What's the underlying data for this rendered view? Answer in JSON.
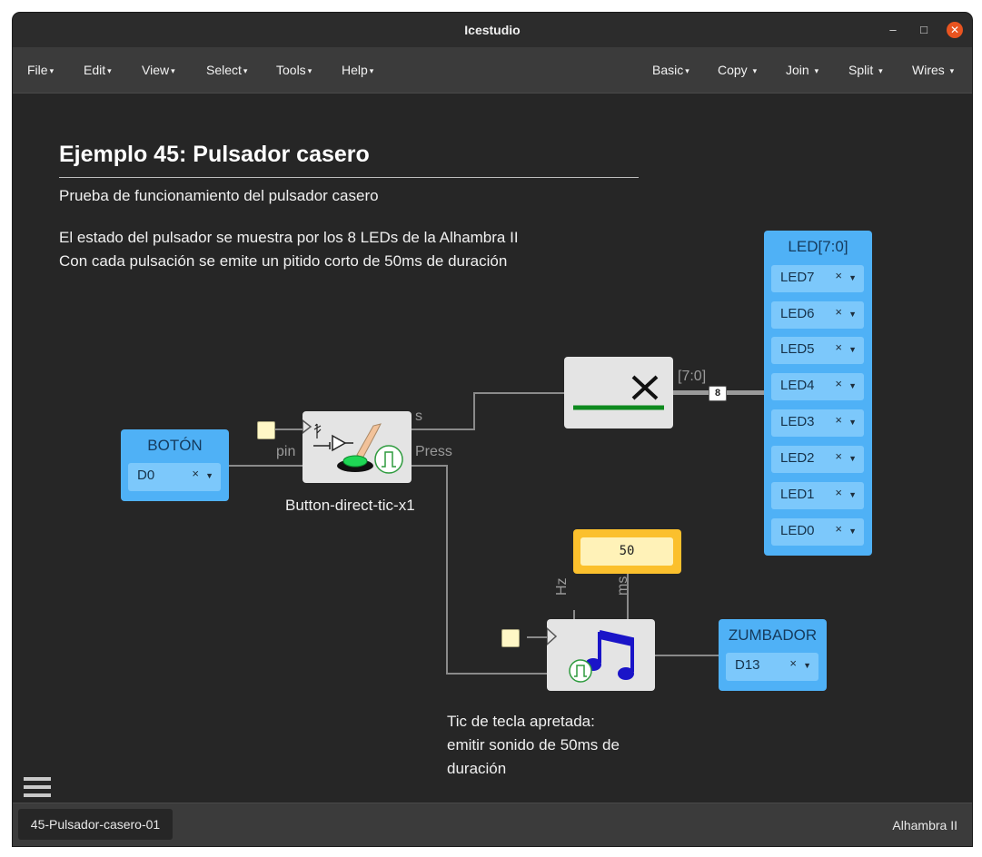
{
  "window": {
    "title": "Icestudio",
    "minimize": "–",
    "maximize": "□",
    "close": "✕"
  },
  "menu": {
    "left": [
      {
        "label": "File",
        "caret": "▾"
      },
      {
        "label": "Edit",
        "caret": "▾"
      },
      {
        "label": "View",
        "caret": "▾"
      },
      {
        "label": "Select",
        "caret": "▾"
      },
      {
        "label": "Tools",
        "caret": "▾"
      },
      {
        "label": "Help",
        "caret": "▾"
      }
    ],
    "right": [
      {
        "label": "Basic",
        "caret": "▾"
      },
      {
        "label": "Copy",
        "caret": "▾"
      },
      {
        "label": "Join",
        "caret": "▾"
      },
      {
        "label": "Split",
        "caret": "▾"
      },
      {
        "label": "Wires",
        "caret": "▾"
      }
    ]
  },
  "canvas": {
    "heading": "Ejemplo 45: Pulsador casero",
    "desc1": "Prueba de funcionamiento del pulsador casero",
    "desc2": "El estado del pulsador se muestra por los 8 LEDs de la Alhambra II",
    "desc3": "Con cada pulsación se emite un pitido corto de 50ms de duración",
    "boton": {
      "label": "BOTÓN",
      "pin": "D0"
    },
    "button_block": {
      "caption": "Button-direct-tic-x1",
      "port_in": "pin",
      "port_s": "s",
      "port_press": "Press"
    },
    "bus": {
      "label": "[7:0]",
      "width": "8"
    },
    "leds": {
      "label": "LED[7:0]",
      "pins": [
        "LED7",
        "LED6",
        "LED5",
        "LED4",
        "LED3",
        "LED2",
        "LED1",
        "LED0"
      ]
    },
    "constant": {
      "value": "50"
    },
    "sound_block": {
      "port_hz": "Hz",
      "port_ms": "ms"
    },
    "zumbador": {
      "label": "ZUMBADOR",
      "pin": "D13"
    },
    "caption2_line1": "Tic de tecla apretada:",
    "caption2_line2": "emitir sonido de 50ms de",
    "caption2_line3": "duración",
    "pin_close": "×",
    "pin_caret": "▼"
  },
  "status": {
    "tab": "45-Pulsador-casero-01",
    "board": "Alhambra II"
  },
  "colors": {
    "io_block": "#4fb1f6",
    "pin_field": "#7cc8fb",
    "constant": "#fbc02d",
    "wire": "#8a8a8a"
  }
}
